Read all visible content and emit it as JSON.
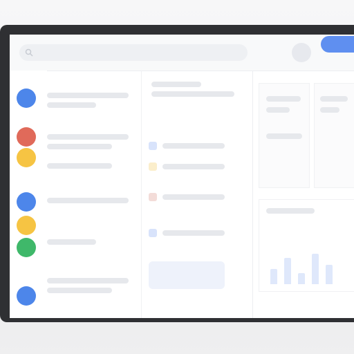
{
  "app": {
    "title": ""
  },
  "theme": {
    "accent": "#5f8ff0",
    "rail_colors": [
      "#4d86ea",
      "#e06a5a",
      "#f6c443",
      "#4d86ea",
      "#f6c443",
      "#3fb86a",
      "#4d86ea"
    ]
  },
  "topbar": {
    "search_placeholder": "",
    "primary_action_label": ""
  },
  "rail": {
    "items": [
      {
        "icon": "blue-app-icon"
      },
      {
        "icon": "red-app-icon"
      },
      {
        "icon": "yellow-app-icon"
      },
      {
        "icon": "blue-app-icon"
      },
      {
        "icon": "yellow-app-icon"
      },
      {
        "icon": "green-app-icon"
      },
      {
        "icon": "blue-app-icon"
      }
    ]
  },
  "list": {
    "items": [
      {
        "label": ""
      },
      {
        "label": ""
      },
      {
        "label": ""
      },
      {
        "label": ""
      },
      {
        "label": ""
      },
      {
        "label": ""
      }
    ]
  },
  "middle": {
    "heading": "",
    "rows": [
      {
        "label": ""
      },
      {
        "label": ""
      },
      {
        "label": ""
      },
      {
        "label": ""
      }
    ]
  },
  "right": {
    "summary": ""
  }
}
